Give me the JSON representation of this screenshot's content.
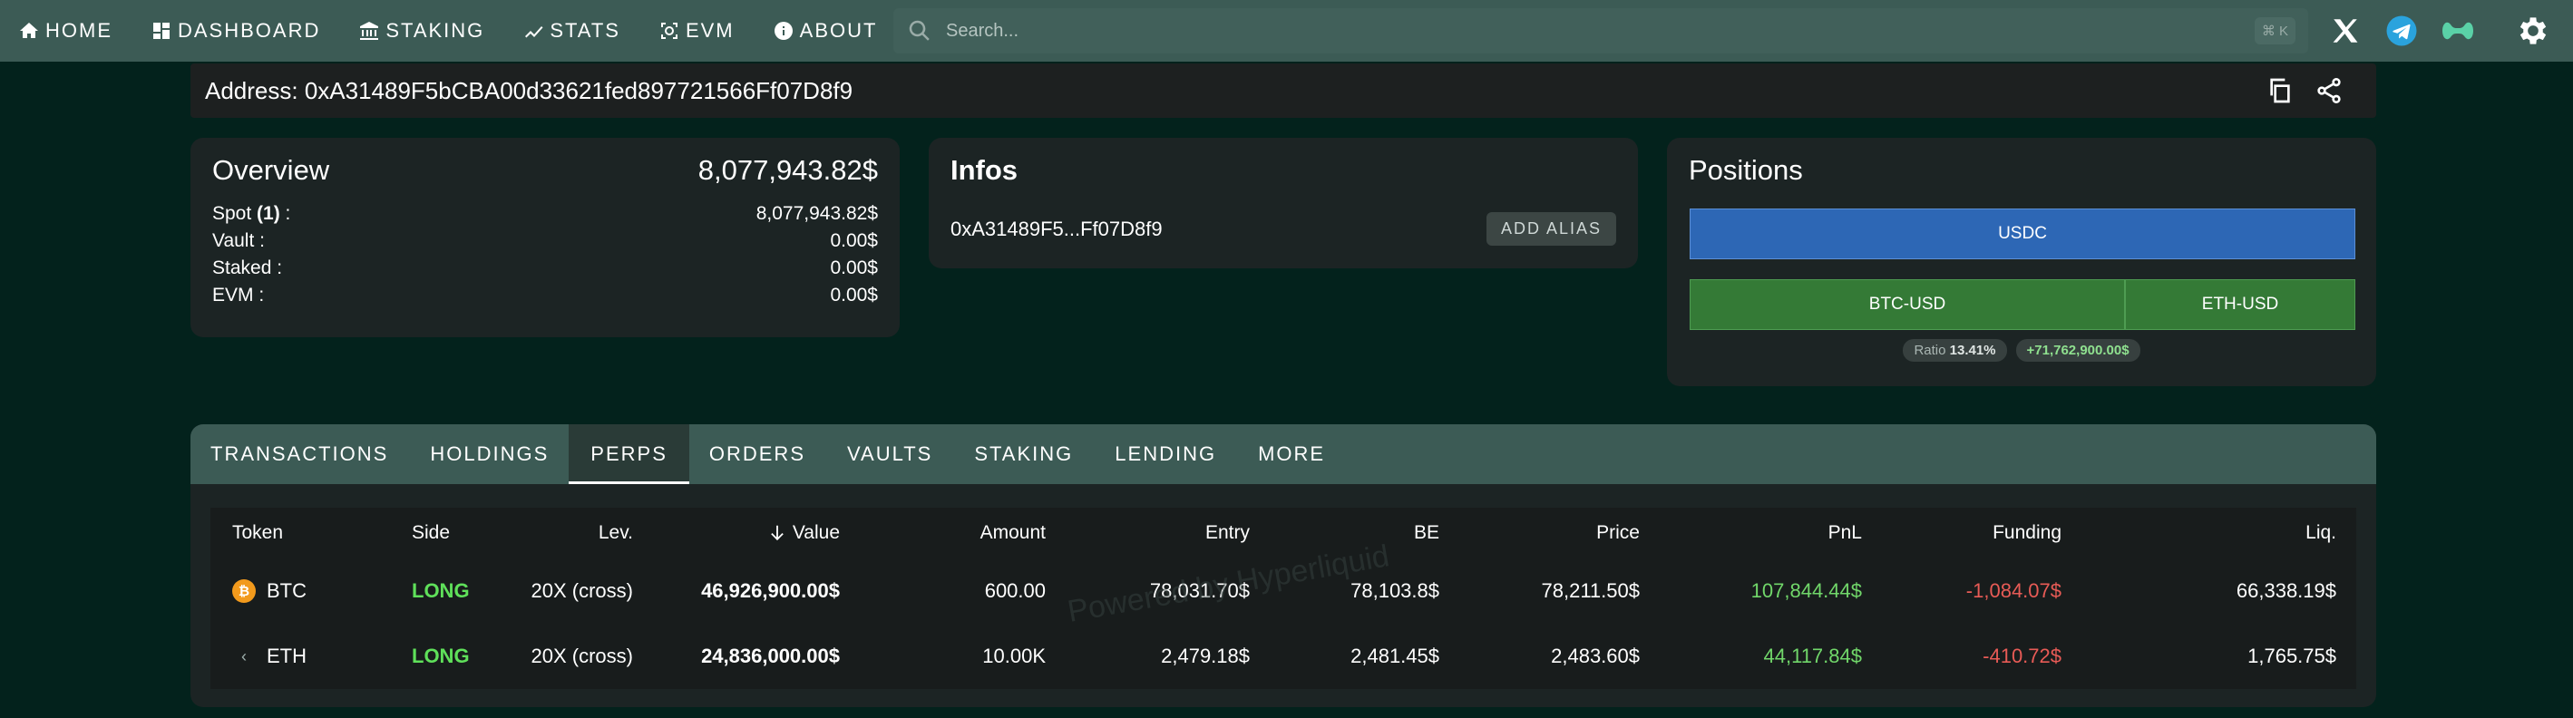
{
  "nav": {
    "items": [
      {
        "label": "HOME",
        "icon": "home-icon"
      },
      {
        "label": "DASHBOARD",
        "icon": "dashboard-icon"
      },
      {
        "label": "STAKING",
        "icon": "bank-icon"
      },
      {
        "label": "STATS",
        "icon": "trend-icon"
      },
      {
        "label": "EVM",
        "icon": "evm-icon"
      },
      {
        "label": "ABOUT",
        "icon": "info-icon"
      }
    ],
    "search_placeholder": "Search...",
    "search_shortcut": "⌘ K"
  },
  "address": {
    "label": "Address: 0xA31489F5bCBA00d33621fed897721566Ff07D8f9"
  },
  "overview": {
    "title": "Overview",
    "total": "8,077,943.82$",
    "rows": [
      {
        "label_pre": "Spot ",
        "label_count": "(1)",
        "label_post": " :",
        "value": "8,077,943.82$"
      },
      {
        "label": "Vault :",
        "value": "0.00$"
      },
      {
        "label": "Staked :",
        "value": "0.00$"
      },
      {
        "label": "EVM :",
        "value": "0.00$"
      }
    ]
  },
  "infos": {
    "title": "Infos",
    "short_address": "0xA31489F5...Ff07D8f9",
    "alias_button": "ADD ALIAS"
  },
  "positions": {
    "title": "Positions",
    "usdc_label": "USDC",
    "btc_label": "BTC-USD",
    "eth_label": "ETH-USD",
    "btc_share": 0.654,
    "ratio_label": "Ratio",
    "ratio_value": "13.41%",
    "total_pill": "+71,762,900.00$"
  },
  "tabs": [
    {
      "label": "TRANSACTIONS"
    },
    {
      "label": "HOLDINGS"
    },
    {
      "label": "PERPS",
      "active": true
    },
    {
      "label": "ORDERS"
    },
    {
      "label": "VAULTS"
    },
    {
      "label": "STAKING"
    },
    {
      "label": "LENDING"
    },
    {
      "label": "MORE"
    }
  ],
  "perps": {
    "headers": {
      "token": "Token",
      "side": "Side",
      "lev": "Lev.",
      "value": "Value",
      "amount": "Amount",
      "entry": "Entry",
      "be": "BE",
      "price": "Price",
      "pnl": "PnL",
      "funding": "Funding",
      "liq": "Liq."
    },
    "rows": [
      {
        "token": "BTC",
        "side": "LONG",
        "lev": "20X (cross)",
        "value": "46,926,900.00$",
        "amount": "600.00",
        "entry": "78,031.70$",
        "be": "78,103.8$",
        "price": "78,211.50$",
        "pnl": "107,844.44$",
        "funding": "-1,084.07$",
        "liq": "66,338.19$"
      },
      {
        "token": "ETH",
        "side": "LONG",
        "lev": "20X (cross)",
        "value": "24,836,000.00$",
        "amount": "10.00K",
        "entry": "2,479.18$",
        "be": "2,481.45$",
        "price": "2,483.60$",
        "pnl": "44,117.84$",
        "funding": "-410.72$",
        "liq": "1,765.75$"
      }
    ]
  },
  "watermark": "Powered by Hyperliquid"
}
